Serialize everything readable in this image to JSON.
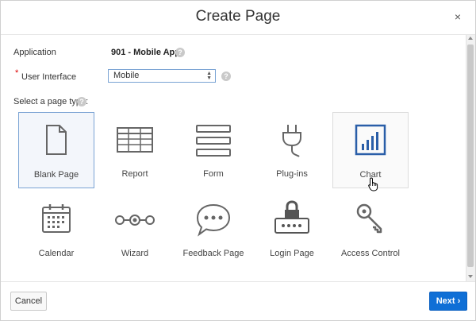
{
  "dialog": {
    "title": "Create Page",
    "close_symbol": "×"
  },
  "form": {
    "application_label": "Application",
    "application_value": "901 - Mobile App",
    "required_marker": "*",
    "ui_label": "User Interface",
    "ui_selected": "Mobile",
    "page_type_label": "Select a page type:"
  },
  "page_types": [
    {
      "label": "Blank Page",
      "icon": "blank-page-icon",
      "state": "selected"
    },
    {
      "label": "Report",
      "icon": "report-table-icon",
      "state": "normal"
    },
    {
      "label": "Form",
      "icon": "form-icon",
      "state": "normal"
    },
    {
      "label": "Plug-ins",
      "icon": "plug-icon",
      "state": "normal"
    },
    {
      "label": "Chart",
      "icon": "bar-chart-icon",
      "state": "hover"
    },
    {
      "label": "Calendar",
      "icon": "calendar-icon",
      "state": "normal"
    },
    {
      "label": "Wizard",
      "icon": "wizard-steps-icon",
      "state": "normal"
    },
    {
      "label": "Feedback Page",
      "icon": "speech-bubble-icon",
      "state": "normal"
    },
    {
      "label": "Login Page",
      "icon": "login-lock-icon",
      "state": "normal"
    },
    {
      "label": "Access Control",
      "icon": "key-icon",
      "state": "normal"
    }
  ],
  "footer": {
    "cancel_label": "Cancel",
    "next_label": "Next"
  },
  "colors": {
    "accent": "#0f6fd6",
    "chart_icon": "#2a5ea8",
    "icon_gray": "#666666"
  }
}
